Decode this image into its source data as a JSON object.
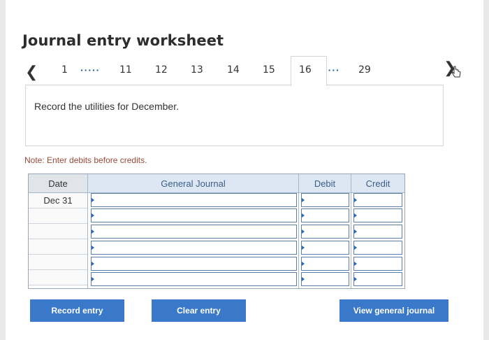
{
  "title": "Journal entry worksheet",
  "nav": {
    "items": [
      "1",
      "11",
      "12",
      "13",
      "14",
      "15",
      "16",
      "29"
    ],
    "dots": "·····",
    "dots2": "····",
    "active": "16",
    "prev_icon": "chevron-left-icon",
    "next_icon": "chevron-right-icon"
  },
  "instruction": "Record the utilities for December.",
  "note": "Note: Enter debits before credits.",
  "journal": {
    "headers": {
      "date": "Date",
      "general_journal": "General Journal",
      "debit": "Debit",
      "credit": "Credit"
    },
    "rows": [
      {
        "date": "Dec 31",
        "account": "",
        "debit": "",
        "credit": ""
      },
      {
        "date": "",
        "account": "",
        "debit": "",
        "credit": ""
      },
      {
        "date": "",
        "account": "",
        "debit": "",
        "credit": ""
      },
      {
        "date": "",
        "account": "",
        "debit": "",
        "credit": ""
      },
      {
        "date": "",
        "account": "",
        "debit": "",
        "credit": ""
      },
      {
        "date": "",
        "account": "",
        "debit": "",
        "credit": ""
      }
    ]
  },
  "buttons": {
    "record": "Record entry",
    "clear": "Clear entry",
    "view": "View general journal"
  },
  "colors": {
    "accent": "#3a78c9",
    "header_bg": "#dde7f3",
    "note": "#9a4a3a"
  }
}
